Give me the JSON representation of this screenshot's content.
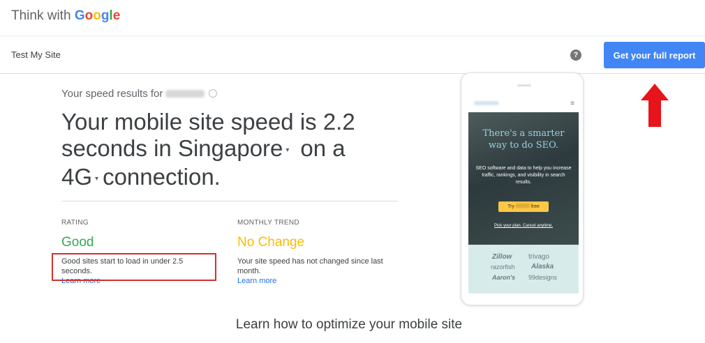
{
  "brand": {
    "think_with": "Think with",
    "google_letters": [
      "G",
      "o",
      "o",
      "g",
      "l",
      "e"
    ]
  },
  "subheader": {
    "title": "Test My Site",
    "help_icon": "question-icon",
    "help_glyph": "?",
    "report_button": "Get your full report"
  },
  "results": {
    "results_for": "Your speed results for",
    "line1": "Your mobile site speed is 2.2",
    "line2_prefix": "seconds in",
    "location": "Singapore",
    "line2_suffix": "on a",
    "connection": "4G",
    "line3_suffix": "connection."
  },
  "rating": {
    "label": "RATING",
    "value": "Good",
    "color": "#34A853",
    "description": "Good sites start to load in under 2.5 seconds.",
    "link": "Learn more"
  },
  "trend": {
    "label": "MONTHLY TREND",
    "value": "No Change",
    "color": "#FBBC05",
    "description": "Your site speed has not changed since last month.",
    "link": "Learn more"
  },
  "phone_preview": {
    "menu_glyph": "≡",
    "headline": "There's a smarter way to do SEO.",
    "body": "SEO software and data to help you increase traffic, rankings, and visibility in search results.",
    "cta_prefix": "Try",
    "cta_suffix": "free",
    "small_link": "Pick your plan. Cancel anytime.",
    "logos": [
      "Zillow",
      "trivago",
      "razorfish",
      "Alaska",
      "Aaron's",
      "99designs"
    ]
  },
  "footer": {
    "learn_title": "Learn how to optimize your mobile site"
  },
  "annotations": {
    "arrow_color": "#e8141b",
    "highlight_color": "#d32f2f"
  }
}
